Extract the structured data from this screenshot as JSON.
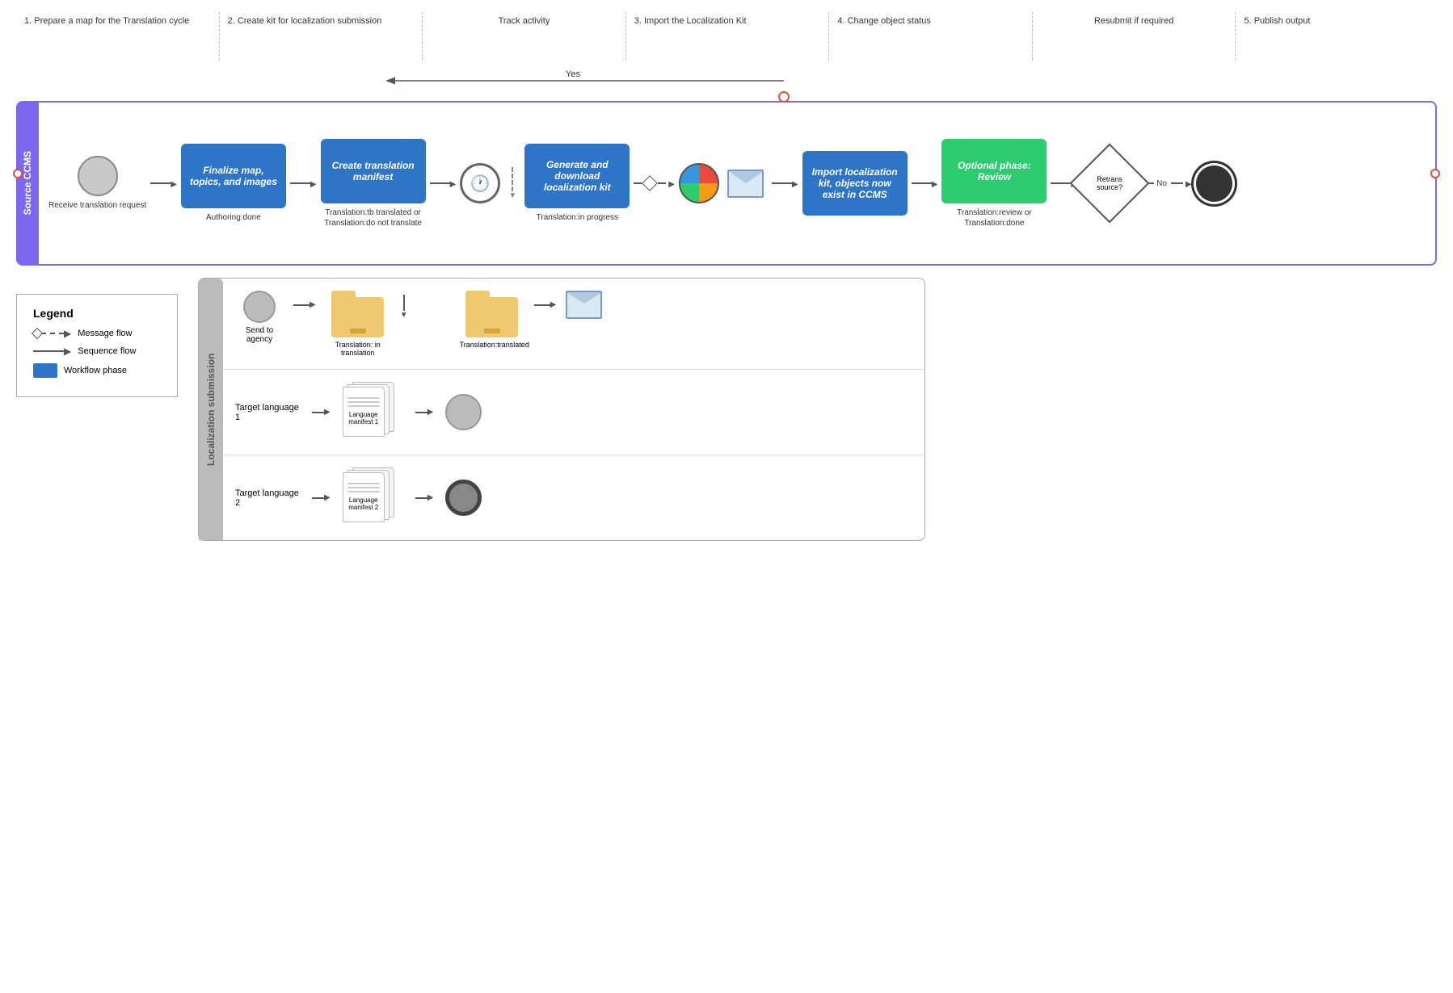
{
  "phases": [
    {
      "num": "1.",
      "label": "Prepare a map for the Translation cycle"
    },
    {
      "num": "2.",
      "label": "Create kit for localization submission"
    },
    {
      "num": "",
      "label": "Track activity"
    },
    {
      "num": "3.",
      "label": "Import the Localization Kit"
    },
    {
      "num": "4.",
      "label": "Change object status"
    },
    {
      "num": "",
      "label": "Resubmit if required"
    },
    {
      "num": "5.",
      "label": "Publish output"
    }
  ],
  "swimlane": {
    "label": "Source CCMS",
    "nodes": [
      {
        "id": "start",
        "type": "circle",
        "label": "Receive translation request"
      },
      {
        "id": "finalize",
        "type": "rect-blue",
        "label": "Finalize map, topics, and images",
        "sublabel": "Authoring:done"
      },
      {
        "id": "create-manifest",
        "type": "rect-blue",
        "label": "Create translation manifest",
        "sublabel": "Translation:tb translated\nor\nTranslation:do not translate"
      },
      {
        "id": "clock1",
        "type": "clock",
        "label": ""
      },
      {
        "id": "gen-kit",
        "type": "rect-blue",
        "label": "Generate and download localization kit",
        "sublabel": "Translation:in progress"
      },
      {
        "id": "diamond1",
        "type": "diamond",
        "label": ""
      },
      {
        "id": "pie",
        "type": "pie",
        "label": ""
      },
      {
        "id": "envelope1",
        "type": "envelope",
        "label": ""
      },
      {
        "id": "import-kit",
        "type": "rect-blue",
        "label": "Import localization kit, objects now exist in CCMS",
        "sublabel": ""
      },
      {
        "id": "optional-review",
        "type": "rect-green",
        "label": "Optional phase: Review",
        "sublabel": "Translation:review\nor\nTranslation:done"
      },
      {
        "id": "retrans",
        "type": "diamond",
        "label": "Retrans source?"
      },
      {
        "id": "end",
        "type": "end-circle",
        "label": ""
      }
    ]
  },
  "track_activity": {
    "label": "Track activity",
    "yes_label": "Yes",
    "no_label": "No"
  },
  "resubmit": {
    "label": "Resubmit if required"
  },
  "loc_submission": {
    "label": "Localization submission",
    "top_flow": {
      "send_to_agency": "Send to agency",
      "translation_in_translation": "Translation:\nin translation",
      "translation_translated": "Translation:translated"
    },
    "lanes": [
      {
        "label": "Target language 1",
        "manifest": "Language manifest 1"
      },
      {
        "label": "Target language 2",
        "manifest": "Language manifest 2"
      }
    ]
  },
  "legend": {
    "title": "Legend",
    "items": [
      {
        "type": "message-flow",
        "label": "Message flow"
      },
      {
        "type": "sequence-flow",
        "label": "Sequence flow"
      },
      {
        "type": "workflow-phase",
        "label": "Workflow phase"
      }
    ]
  }
}
